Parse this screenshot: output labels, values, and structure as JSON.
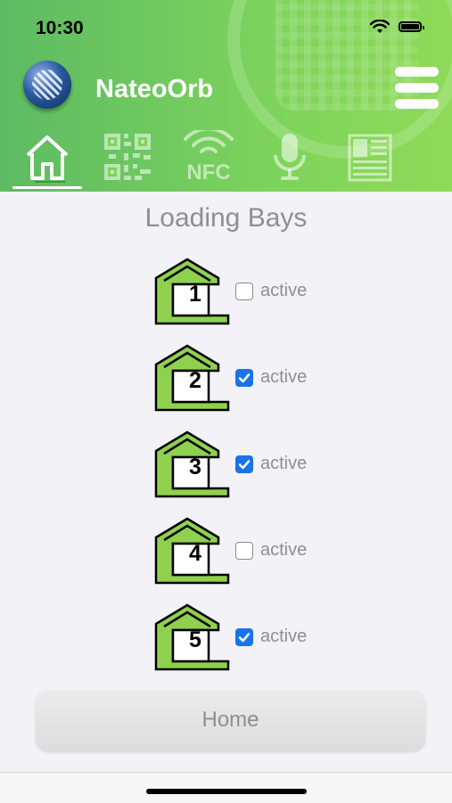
{
  "status_bar": {
    "time": "10:30"
  },
  "header": {
    "app_title": "NateoOrb"
  },
  "nav": {
    "items": [
      {
        "name": "home",
        "icon": "home-icon",
        "active": true
      },
      {
        "name": "qr",
        "icon": "qr-code-icon",
        "active": false
      },
      {
        "name": "nfc",
        "icon": "nfc-icon",
        "label": "NFC",
        "active": false
      },
      {
        "name": "voice",
        "icon": "microphone-icon",
        "active": false
      },
      {
        "name": "document",
        "icon": "document-icon",
        "active": false
      }
    ]
  },
  "main": {
    "heading": "Loading Bays",
    "bays": [
      {
        "number": "1",
        "label": "active",
        "checked": false
      },
      {
        "number": "2",
        "label": "active",
        "checked": true
      },
      {
        "number": "3",
        "label": "active",
        "checked": true
      },
      {
        "number": "4",
        "label": "active",
        "checked": false
      },
      {
        "number": "5",
        "label": "active",
        "checked": true
      }
    ],
    "home_button": "Home"
  },
  "colors": {
    "header_start": "#5dbb63",
    "header_end": "#8fda58",
    "bay_fill": "#8fd14f",
    "checkbox_on": "#1a73e8",
    "text_gray": "#8e8e93"
  }
}
